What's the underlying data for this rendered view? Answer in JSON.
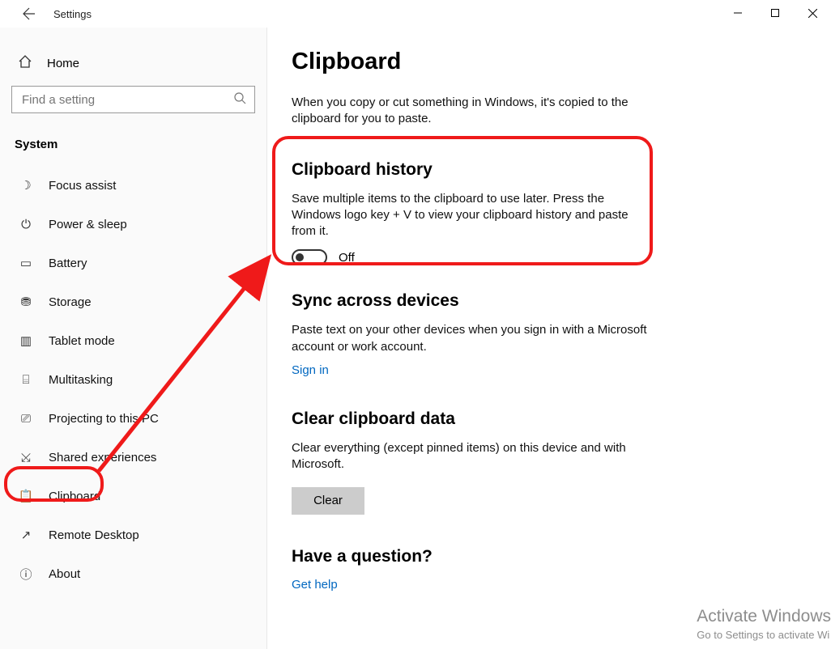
{
  "window": {
    "title": "Settings",
    "controls": {
      "minimize": "—",
      "maximize": "▢",
      "close": "✕"
    }
  },
  "sidebar": {
    "home_label": "Home",
    "search_placeholder": "Find a setting",
    "category": "System",
    "items": [
      {
        "icon": "moon-icon",
        "glyph": "☽",
        "label": "Focus assist"
      },
      {
        "icon": "power-icon",
        "glyph": "⏻",
        "label": "Power & sleep"
      },
      {
        "icon": "battery-icon",
        "glyph": "▭",
        "label": "Battery"
      },
      {
        "icon": "storage-icon",
        "glyph": "⛃",
        "label": "Storage"
      },
      {
        "icon": "tablet-icon",
        "glyph": "▥",
        "label": "Tablet mode"
      },
      {
        "icon": "multitask-icon",
        "glyph": "⌸",
        "label": "Multitasking"
      },
      {
        "icon": "project-icon",
        "glyph": "⎚",
        "label": "Projecting to this PC"
      },
      {
        "icon": "shared-icon",
        "glyph": "⤩",
        "label": "Shared experiences"
      },
      {
        "icon": "clipboard-icon",
        "glyph": "📋",
        "label": "Clipboard"
      },
      {
        "icon": "remote-icon",
        "glyph": "↗",
        "label": "Remote Desktop"
      },
      {
        "icon": "about-icon",
        "glyph": "ⓘ",
        "label": "About"
      }
    ]
  },
  "page": {
    "heading": "Clipboard",
    "intro": "When you copy or cut something in Windows, it's copied to the clipboard for you to paste.",
    "history": {
      "heading": "Clipboard history",
      "desc": "Save multiple items to the clipboard to use later. Press the Windows logo key + V to view your clipboard history and paste from it.",
      "toggle_state": "Off"
    },
    "sync": {
      "heading": "Sync across devices",
      "desc": "Paste text on your other devices when you sign in with a Microsoft account or work account.",
      "link": "Sign in"
    },
    "clear": {
      "heading": "Clear clipboard data",
      "desc": "Clear everything (except pinned items) on this device and with Microsoft.",
      "button": "Clear"
    },
    "help": {
      "heading": "Have a question?",
      "link": "Get help"
    }
  },
  "watermark": {
    "title": "Activate Windows",
    "subtitle": "Go to Settings to activate Wi"
  }
}
